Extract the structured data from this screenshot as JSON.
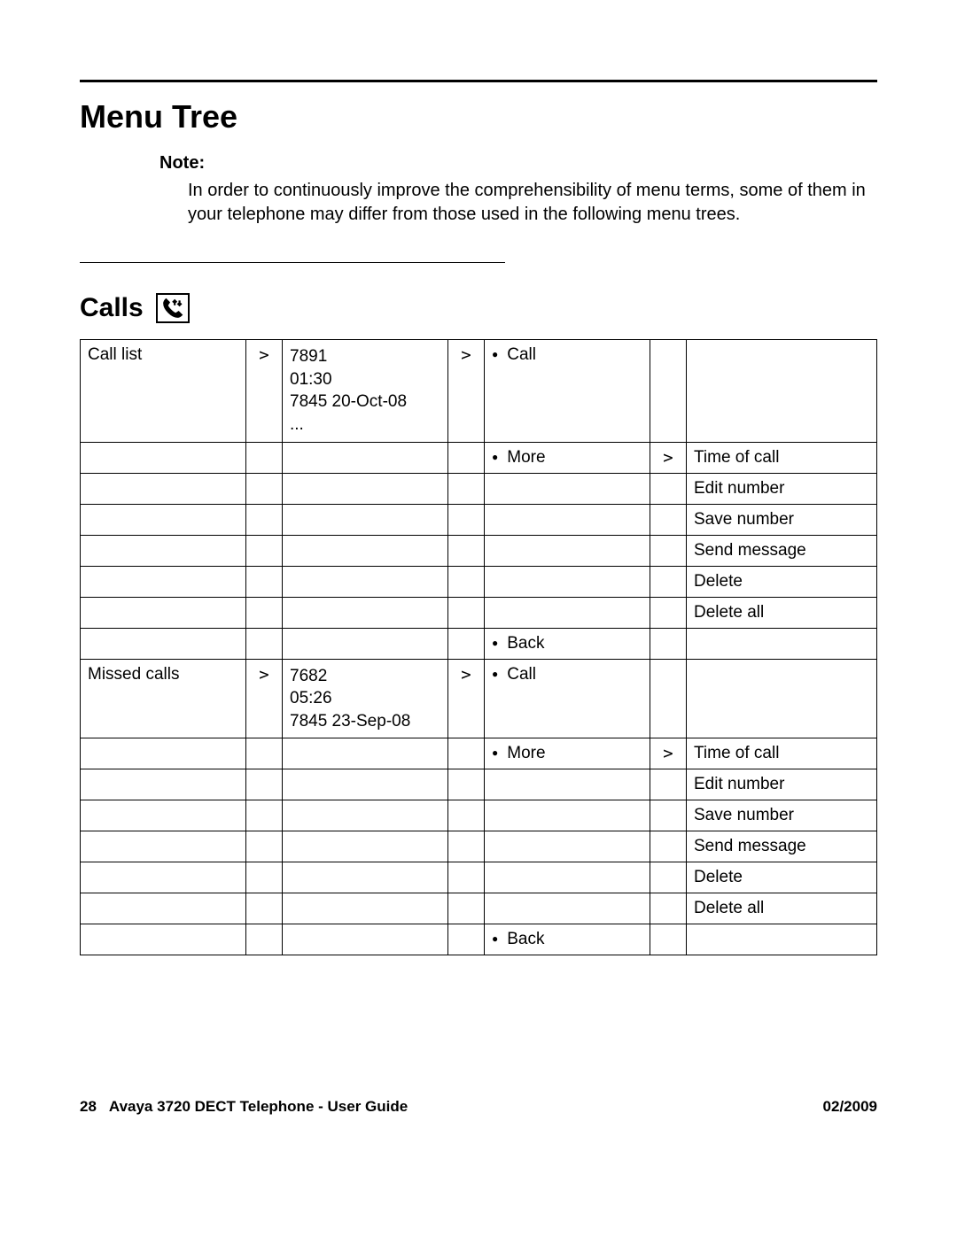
{
  "title": "Menu Tree",
  "note": {
    "label": "Note:",
    "body": "In order to continuously improve the comprehensibility of menu terms, some of them in your telephone may differ from those used in the following menu trees."
  },
  "section": {
    "heading": "Calls"
  },
  "chevron": ">",
  "rows": [
    {
      "c1": "Call list",
      "c2": ">",
      "c3_lines": [
        "7891",
        "01:30",
        "7845 20-Oct-08",
        "..."
      ],
      "c4": ">",
      "c5": "Call",
      "c5_bullet": true,
      "c6": "",
      "c7": ""
    },
    {
      "c1": "",
      "c2": "",
      "c3_lines": [],
      "c4": "",
      "c5": "More",
      "c5_bullet": true,
      "c6": ">",
      "c7": "Time of call"
    },
    {
      "c1": "",
      "c2": "",
      "c3_lines": [],
      "c4": "",
      "c5": "",
      "c5_bullet": false,
      "c6": "",
      "c7": "Edit number"
    },
    {
      "c1": "",
      "c2": "",
      "c3_lines": [],
      "c4": "",
      "c5": "",
      "c5_bullet": false,
      "c6": "",
      "c7": "Save number"
    },
    {
      "c1": "",
      "c2": "",
      "c3_lines": [],
      "c4": "",
      "c5": "",
      "c5_bullet": false,
      "c6": "",
      "c7": "Send message"
    },
    {
      "c1": "",
      "c2": "",
      "c3_lines": [],
      "c4": "",
      "c5": "",
      "c5_bullet": false,
      "c6": "",
      "c7": "Delete"
    },
    {
      "c1": "",
      "c2": "",
      "c3_lines": [],
      "c4": "",
      "c5": "",
      "c5_bullet": false,
      "c6": "",
      "c7": "Delete all"
    },
    {
      "c1": "",
      "c2": "",
      "c3_lines": [],
      "c4": "",
      "c5": "Back",
      "c5_bullet": true,
      "c6": "",
      "c7": ""
    },
    {
      "c1": "Missed calls",
      "c2": ">",
      "c3_lines": [
        "7682",
        "05:26",
        "7845 23-Sep-08"
      ],
      "c4": ">",
      "c5": "Call",
      "c5_bullet": true,
      "c6": "",
      "c7": ""
    },
    {
      "c1": "",
      "c2": "",
      "c3_lines": [],
      "c4": "",
      "c5": "More",
      "c5_bullet": true,
      "c6": ">",
      "c7": "Time of call"
    },
    {
      "c1": "",
      "c2": "",
      "c3_lines": [],
      "c4": "",
      "c5": "",
      "c5_bullet": false,
      "c6": "",
      "c7": "Edit number"
    },
    {
      "c1": "",
      "c2": "",
      "c3_lines": [],
      "c4": "",
      "c5": "",
      "c5_bullet": false,
      "c6": "",
      "c7": "Save number"
    },
    {
      "c1": "",
      "c2": "",
      "c3_lines": [],
      "c4": "",
      "c5": "",
      "c5_bullet": false,
      "c6": "",
      "c7": "Send message"
    },
    {
      "c1": "",
      "c2": "",
      "c3_lines": [],
      "c4": "",
      "c5": "",
      "c5_bullet": false,
      "c6": "",
      "c7": "Delete"
    },
    {
      "c1": "",
      "c2": "",
      "c3_lines": [],
      "c4": "",
      "c5": "",
      "c5_bullet": false,
      "c6": "",
      "c7": "Delete all"
    },
    {
      "c1": "",
      "c2": "",
      "c3_lines": [],
      "c4": "",
      "c5": "Back",
      "c5_bullet": true,
      "c6": "",
      "c7": ""
    }
  ],
  "footer": {
    "page": "28",
    "doc": "Avaya 3720 DECT Telephone - User Guide",
    "date": "02/2009"
  }
}
